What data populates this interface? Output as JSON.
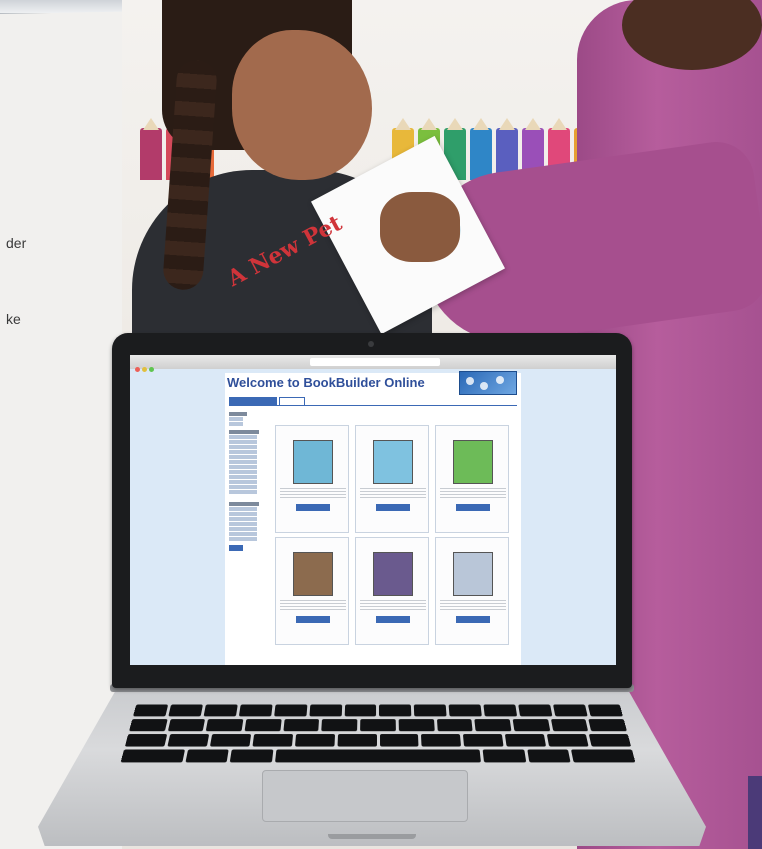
{
  "left_panel": {
    "snippet_1": "der",
    "snippet_2": "ke"
  },
  "booklet": {
    "title": "A New Pet"
  },
  "site": {
    "title": "Welcome to BookBuilder Online",
    "tabs": [
      "",
      ""
    ],
    "nav_links": [
      "",
      "",
      "",
      ""
    ],
    "results_header": "",
    "books": [
      {
        "title": "",
        "author": "",
        "read_label": "",
        "cover_color": "#6fb7d6"
      },
      {
        "title": "",
        "author": "",
        "read_label": "",
        "cover_color": "#7fc2e0"
      },
      {
        "title": "",
        "author": "",
        "read_label": "",
        "cover_color": "#6dbb58"
      },
      {
        "title": "",
        "author": "",
        "read_label": "",
        "cover_color": "#8c6b4e"
      },
      {
        "title": "",
        "author": "",
        "read_label": "",
        "cover_color": "#6a5a8e"
      },
      {
        "title": "",
        "author": "",
        "read_label": "",
        "cover_color": "#b9c6d8"
      }
    ]
  },
  "colors": {
    "site_blue": "#3b69b5",
    "teacher_top": "#a64f8e",
    "screen_bg": "#dbe9f7"
  }
}
